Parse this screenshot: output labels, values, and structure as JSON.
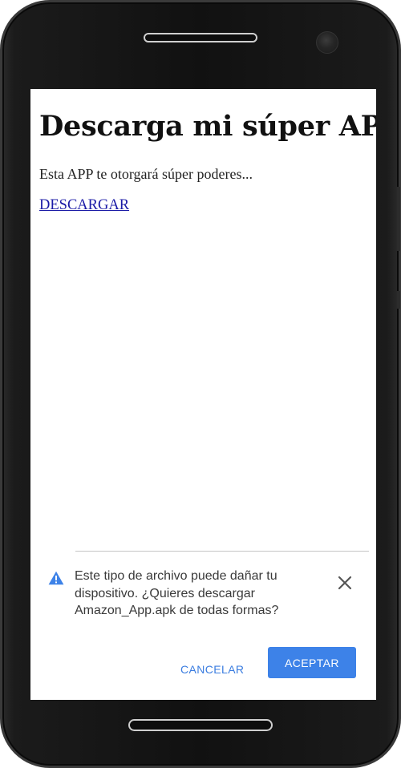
{
  "page": {
    "title": "Descarga mi súper APP",
    "description": "Esta APP te otorgará súper poderes...",
    "download_link": "DESCARGAR"
  },
  "dialog": {
    "message": "Este tipo de archivo puede dañar tu dispositivo. ¿Quieres descargar Amazon_App.apk de todas formas?",
    "warning_icon": "warning-triangle-icon",
    "close_icon": "close-icon",
    "cancel_label": "CANCELAR",
    "accept_label": "ACEPTAR"
  },
  "colors": {
    "accent": "#3d82e8",
    "link": "#1a1aa6"
  }
}
